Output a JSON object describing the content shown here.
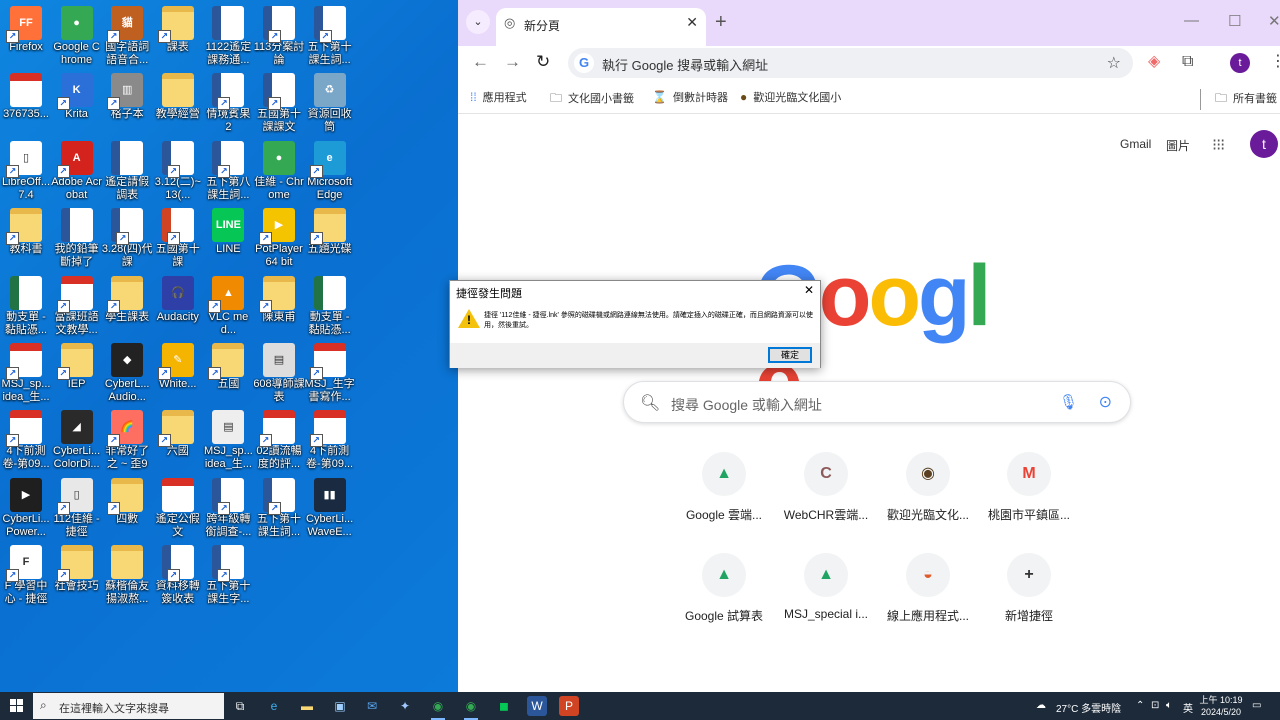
{
  "colors": {
    "desktop_bg": "#0a78d4",
    "tabbar_bg": "#e9d9fb",
    "profile": "#6a1b9a",
    "taskbar": "#1c2a3a"
  },
  "desktop_icons": [
    {
      "label": "Firefox",
      "icon": "firefox-icon",
      "type": "app",
      "color": "#ff7139",
      "glyph": "FF"
    },
    {
      "label": "Google Chrome",
      "icon": "chrome-icon",
      "type": "app",
      "color": "#34a853",
      "glyph": "●"
    },
    {
      "label": "國字語詞語音合...",
      "icon": "cat-app-icon",
      "type": "app",
      "color": "#c06020",
      "glyph": "貓"
    },
    {
      "label": "課表",
      "icon": "folder-icon",
      "type": "folder"
    },
    {
      "label": "1122遙定課務通...",
      "icon": "word-doc-icon",
      "type": "word"
    },
    {
      "label": "113分案討論",
      "icon": "word-doc-icon",
      "type": "word"
    },
    {
      "label": "五下第十課生詞...",
      "icon": "word-doc-icon",
      "type": "word"
    },
    {
      "label": "376735...",
      "icon": "pdf-icon",
      "type": "pdf"
    },
    {
      "label": "Krita",
      "icon": "krita-icon",
      "type": "app",
      "color": "#2b6fd8",
      "glyph": "K"
    },
    {
      "label": "格子本",
      "icon": "file-icon",
      "type": "app",
      "color": "#8a8a8a",
      "glyph": "▥"
    },
    {
      "label": "教學經營",
      "icon": "folder-icon",
      "type": "folder"
    },
    {
      "label": "情境賓果 2",
      "icon": "word-doc-icon",
      "type": "word"
    },
    {
      "label": "五國第十課課文",
      "icon": "word-doc-icon",
      "type": "word"
    },
    {
      "label": "資源回收筒",
      "icon": "recycle-bin-icon",
      "type": "app",
      "color": "#7aa6c8",
      "glyph": "♻"
    },
    {
      "label": "LibreOff... 7.4",
      "icon": "libreoffice-icon",
      "type": "app",
      "color": "#ffffff",
      "glyph": "▯"
    },
    {
      "label": "Adobe Acrobat",
      "icon": "acrobat-icon",
      "type": "app",
      "color": "#d4221c",
      "glyph": "A"
    },
    {
      "label": "遙定請假調表",
      "icon": "word-doc-icon",
      "type": "word"
    },
    {
      "label": "3.12(二)~13(...",
      "icon": "word-doc-icon",
      "type": "word"
    },
    {
      "label": "五下第八課生詞...",
      "icon": "word-doc-icon",
      "type": "word"
    },
    {
      "label": "佳維 - Chrome",
      "icon": "chrome-profile-icon",
      "type": "app",
      "color": "#34a853",
      "glyph": "●"
    },
    {
      "label": "Microsoft Edge",
      "icon": "edge-icon",
      "type": "app",
      "color": "#1d9bd7",
      "glyph": "e"
    },
    {
      "label": "教科書",
      "icon": "folder-icon",
      "type": "folder"
    },
    {
      "label": "我的鉛筆斷掉了",
      "icon": "word-doc-icon",
      "type": "word"
    },
    {
      "label": "3.28(四)代課",
      "icon": "word-doc-icon",
      "type": "word"
    },
    {
      "label": "五國第十課",
      "icon": "ppt-icon",
      "type": "ppt"
    },
    {
      "label": "LINE",
      "icon": "line-icon",
      "type": "app",
      "color": "#06c755",
      "glyph": "LINE"
    },
    {
      "label": "PotPlayer 64 bit",
      "icon": "potplayer-icon",
      "type": "app",
      "color": "#f5c400",
      "glyph": "▶"
    },
    {
      "label": "五題光碟",
      "icon": "folder-icon",
      "type": "folder"
    },
    {
      "label": "動支單 - 黏貼憑...",
      "icon": "excel-icon",
      "type": "excel"
    },
    {
      "label": "當課班語文教學...",
      "icon": "pdf-icon",
      "type": "pdf"
    },
    {
      "label": "學生課表",
      "icon": "folder-icon",
      "type": "folder"
    },
    {
      "label": "Audacity",
      "icon": "audacity-icon",
      "type": "app",
      "color": "#2f3fa8",
      "glyph": "🎧"
    },
    {
      "label": "VLC med...",
      "icon": "vlc-icon",
      "type": "app",
      "color": "#f08a00",
      "glyph": "▲"
    },
    {
      "label": "陳東甫",
      "icon": "folder-icon",
      "type": "folder"
    },
    {
      "label": "動支單 - 黏貼憑...",
      "icon": "excel-icon",
      "type": "excel"
    },
    {
      "label": "MSJ_sp... idea_生...",
      "icon": "pdf-icon",
      "type": "pdf"
    },
    {
      "label": "IEP",
      "icon": "folder-icon",
      "type": "folder"
    },
    {
      "label": "CyberL... Audio...",
      "icon": "cyberlink-audio-icon",
      "type": "app",
      "color": "#222",
      "glyph": "◆"
    },
    {
      "label": "White...",
      "icon": "whiteboard-icon",
      "type": "app",
      "color": "#f5b400",
      "glyph": "✎"
    },
    {
      "label": "五國",
      "icon": "folder-icon",
      "type": "folder"
    },
    {
      "label": "608導師課表",
      "icon": "file-icon",
      "type": "app",
      "color": "#dddddd",
      "glyph": "▤"
    },
    {
      "label": "MSJ_生字書寫作...",
      "icon": "pdf-icon",
      "type": "pdf"
    },
    {
      "label": "4下前測卷-第09...",
      "icon": "pdf-icon",
      "type": "pdf"
    },
    {
      "label": "CyberLi... ColorDi...",
      "icon": "colordirector-icon",
      "type": "app",
      "color": "#2a2a2a",
      "glyph": "◢"
    },
    {
      "label": "非常好了之 ~ 歪9",
      "icon": "rainbow-app-icon",
      "type": "app",
      "color": "#ff6f61",
      "glyph": "🌈"
    },
    {
      "label": "六國",
      "icon": "folder-icon",
      "type": "folder"
    },
    {
      "label": "MSJ_sp... idea_生...",
      "icon": "file-icon",
      "type": "app",
      "color": "#eeeeee",
      "glyph": "▤"
    },
    {
      "label": "02讀流暢度的評...",
      "icon": "pdf-icon",
      "type": "pdf"
    },
    {
      "label": "4下前測卷-第09...",
      "icon": "pdf-icon",
      "type": "pdf"
    },
    {
      "label": "CyberLi... Power...",
      "icon": "powerdirector-icon",
      "type": "app",
      "color": "#1f1f1f",
      "glyph": "▶"
    },
    {
      "label": "112佳維 - 捷徑",
      "icon": "file-icon",
      "type": "app",
      "color": "#e8e8e8",
      "glyph": "▯"
    },
    {
      "label": "四數",
      "icon": "folder-icon",
      "type": "folder"
    },
    {
      "label": "遙定公假文",
      "icon": "pdf-icon",
      "type": "pdf"
    },
    {
      "label": "跨年級轉銜調查-...",
      "icon": "word-doc-icon",
      "type": "word"
    },
    {
      "label": "五下第十課生詞...",
      "icon": "word-doc-icon",
      "type": "word"
    },
    {
      "label": "CyberLi... WaveE...",
      "icon": "waveeditor-icon",
      "type": "app",
      "color": "#1a2a40",
      "glyph": "▮▮"
    },
    {
      "label": "F 學習中心 - 捷徑",
      "icon": "file-icon",
      "type": "app",
      "color": "#ffffff",
      "glyph": "F"
    },
    {
      "label": "社會技巧",
      "icon": "folder-icon",
      "type": "folder"
    },
    {
      "label": "蘇楷倫友揚淑熬...",
      "icon": "folder-icon",
      "type": "folder"
    },
    {
      "label": "資料移轉簽收表",
      "icon": "word-doc-icon",
      "type": "word"
    },
    {
      "label": "五下第十課生字...",
      "icon": "word-doc-icon",
      "type": "word"
    }
  ],
  "browser": {
    "tab_title": "新分頁",
    "address_placeholder": "執行 Google 搜尋或輸入網址",
    "bookmarks": [
      {
        "label": "應用程式",
        "icon": "apps-grid-icon"
      },
      {
        "label": "文化國小書籤",
        "icon": "folder-icon"
      },
      {
        "label": "倒數計時器",
        "icon": "hourglass-icon"
      },
      {
        "label": "歡迎光臨文化國小",
        "icon": "school-logo-icon"
      }
    ],
    "all_bookmarks": "所有書籤",
    "profile_initial": "t"
  },
  "ntp": {
    "gmail": "Gmail",
    "images": "圖片",
    "search_placeholder": "搜尋 Google 或輸入網址",
    "logo_letters": [
      "G",
      "o",
      "o",
      "g",
      "l",
      "e"
    ],
    "logo_colors": [
      "#4285f4",
      "#ea4335",
      "#fbbc05",
      "#4285f4",
      "#34a853",
      "#ea4335"
    ],
    "shortcuts": [
      {
        "label": "Google 雲端...",
        "icon": "google-drive-icon",
        "glyph": "▲",
        "color": "#1fa463"
      },
      {
        "label": "WebCHR雲端...",
        "icon": "webchr-icon",
        "glyph": "C",
        "color": "#8d5a5a"
      },
      {
        "label": "歡迎光臨文化...",
        "icon": "school-logo-icon",
        "glyph": "◉",
        "color": "#5a4020"
      },
      {
        "label": "桃園市平鎮區...",
        "icon": "gmail-icon",
        "glyph": "M",
        "color": "#ea4335"
      },
      {
        "label": "Google 試算表",
        "icon": "google-drive-icon",
        "glyph": "▲",
        "color": "#1fa463"
      },
      {
        "label": "MSJ_special i...",
        "icon": "google-drive-icon",
        "glyph": "▲",
        "color": "#1fa463"
      },
      {
        "label": "線上應用程式...",
        "icon": "web-app-icon",
        "glyph": "◒",
        "color": "#e05a2a"
      },
      {
        "label": "新增捷徑",
        "icon": "add-icon",
        "glyph": "+",
        "color": "#333333"
      }
    ]
  },
  "dialog": {
    "title": "捷徑發生問題",
    "message": "捷徑 '112佳維 - 捷徑.lnk' 參照的磁碟機或網路連線無法使用。請確定插入的磁碟正確，而且網路資源可以使用，然後重試。",
    "ok": "確定"
  },
  "taskbar": {
    "search_placeholder": "在這裡輸入文字來搜尋",
    "weather": "27°C 多雲時陰",
    "ime": "英",
    "time": "上午 10:19",
    "date": "2024/5/20"
  }
}
